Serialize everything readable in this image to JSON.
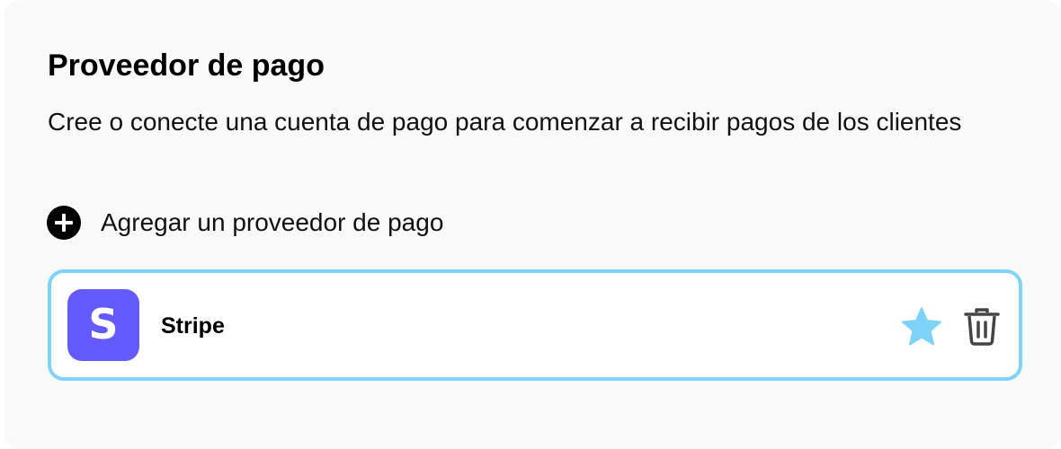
{
  "section": {
    "title": "Proveedor de pago",
    "description": "Cree o conecte una cuenta de pago para comenzar a recibir pagos de los clientes"
  },
  "add_provider": {
    "label": "Agregar un proveedor de pago",
    "icon": "plus-circle-icon"
  },
  "providers": [
    {
      "name": "Stripe",
      "logo_letter": "S",
      "logo_color": "#635bff",
      "default": true,
      "actions": {
        "default_icon": "star-icon",
        "delete_icon": "trash-icon"
      }
    }
  ],
  "colors": {
    "accent": "#7fd3f8",
    "star": "#7fd3f8",
    "stripe_brand": "#635bff"
  }
}
